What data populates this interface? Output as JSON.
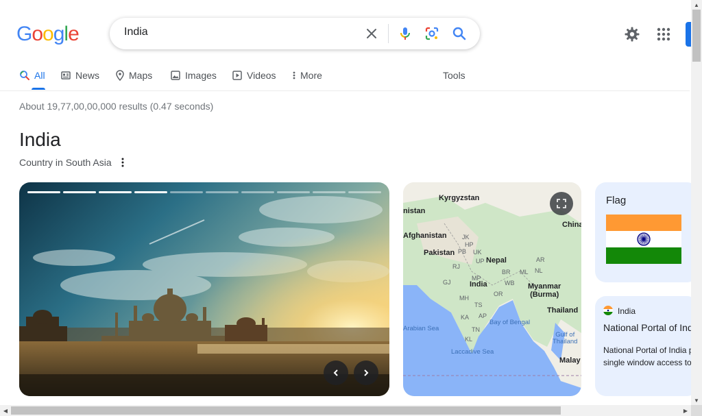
{
  "logo": {
    "letters": [
      {
        "ch": "G",
        "color": "#4285f4"
      },
      {
        "ch": "o",
        "color": "#ea4335"
      },
      {
        "ch": "o",
        "color": "#fbbc05"
      },
      {
        "ch": "g",
        "color": "#4285f4"
      },
      {
        "ch": "l",
        "color": "#34a853"
      },
      {
        "ch": "e",
        "color": "#ea4335"
      }
    ]
  },
  "search": {
    "value": "India",
    "icons": [
      "close-icon",
      "microphone-icon",
      "lens-icon",
      "search-icon"
    ]
  },
  "header_icons": [
    "gear-icon",
    "apps-grid-icon"
  ],
  "tabs": {
    "all": "All",
    "news": "News",
    "maps": "Maps",
    "images": "Images",
    "videos": "Videos",
    "more": "More",
    "tools": "Tools"
  },
  "results_stats": "About 19,77,00,00,000 results (0.47 seconds)",
  "knowledge_panel": {
    "title": "India",
    "subtitle": "Country in South Asia",
    "carousel": {
      "total_slides": 10,
      "current_slide_index": 4
    },
    "map": {
      "labels": {
        "kyrgyzstan": "Kyrgyzstan",
        "tajikistan_partial": "nistan",
        "china_partial": "China",
        "afghanistan": "Afghanistan",
        "pakistan": "Pakistan",
        "nepal": "Nepal",
        "india": "India",
        "myanmar": "Myanmar\n(Burma)",
        "thailand": "Thailand",
        "malaysia_partial": "Malay",
        "arabian_sea": "Arabian Sea",
        "bay_of_bengal": "Bay of Bengal",
        "laccadive_sea": "Laccadive Sea",
        "gulf_of_thailand": "Gulf of\nThailand",
        "states": [
          "JK",
          "HP",
          "PB",
          "UK",
          "UP",
          "RJ",
          "GJ",
          "MP",
          "BR",
          "WB",
          "AR",
          "ML",
          "NL",
          "MH",
          "OR",
          "TS",
          "KA",
          "AP",
          "TN",
          "KL"
        ]
      }
    },
    "flag_card": {
      "label": "Flag",
      "colors": {
        "saffron": "#ff9933",
        "white": "#ffffff",
        "green": "#138808",
        "chakra": "#000080"
      }
    },
    "portal_card": {
      "site": "India",
      "title": "National Portal of India",
      "description": "National Portal of India provides a single window access to information"
    }
  }
}
